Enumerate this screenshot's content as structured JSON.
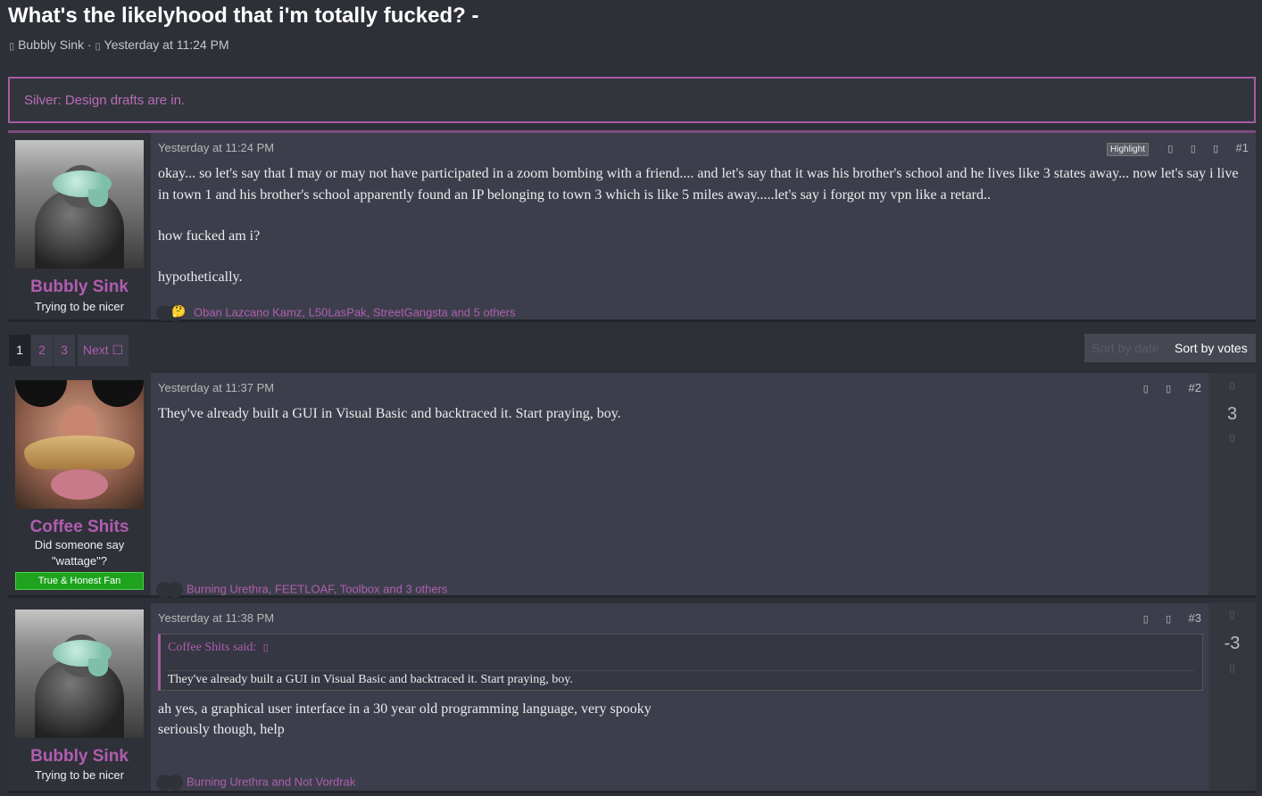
{
  "thread": {
    "title": "What's the likelyhood that i'm totally fucked? -",
    "author": "Bubbly Sink",
    "separator": "·",
    "date": "Yesterday at 11:24 PM",
    "user_icon": "user-icon",
    "clock_icon": "clock-icon"
  },
  "notice": {
    "text": "Silver: Design drafts are in."
  },
  "pagination": {
    "pages": [
      "1",
      "2",
      "3"
    ],
    "current": "1",
    "next_label": "Next ☐"
  },
  "sort": {
    "by_date": "Sort by date",
    "by_votes": "Sort by votes"
  },
  "posts": [
    {
      "author": "Bubbly Sink",
      "user_title": "Trying to be nicer",
      "date": "Yesterday at 11:24 PM",
      "number": "#1",
      "highlight_label": "Highlight",
      "paragraphs": [
        "okay... so let's say that I may or may not have participated in a zoom bombing with a friend.... and let's say that it was his brother's school and he lives like 3 states away... now let's say i live in town 1 and his brother's school apparently found an IP belonging to town 3 which is like 5 miles away.....let's say i forgot my vpn like a retard..",
        "how fucked am i?",
        "hypothetically."
      ],
      "reaction_emoji": "🤔",
      "reactions": "Oban Lazcano Kamz, L50LasPak, StreetGangsta and 5 others"
    },
    {
      "author": "Coffee Shits",
      "user_title": "Did someone say \"wattage\"?",
      "badge": "True & Honest Fan",
      "date": "Yesterday at 11:37 PM",
      "number": "#2",
      "paragraphs": [
        "They've already built a GUI in Visual Basic and backtraced it. Start praying, boy."
      ],
      "reactions": "Burning Urethra, FEETLOAF, Toolbox and 3 others",
      "score": "3"
    },
    {
      "author": "Bubbly Sink",
      "user_title": "Trying to be nicer",
      "date": "Yesterday at 11:38 PM",
      "number": "#3",
      "quote": {
        "header": "Coffee Shits said:",
        "body": "They've already built a GUI in Visual Basic and backtraced it. Start praying, boy."
      },
      "paragraphs": [
        "ah yes, a graphical user interface in a 30 year old programming language, very spooky",
        "seriously though, help"
      ],
      "reactions": "Burning Urethra and Not Vordrak",
      "score": "-3"
    }
  ],
  "icons": {
    "share": "share-icon",
    "bookmark": "bookmark-icon",
    "report": "report-icon",
    "upvote": "upvote-icon",
    "downvote": "downvote-icon",
    "quote_arrow": "quote-jump-icon",
    "glyph": "▯"
  }
}
